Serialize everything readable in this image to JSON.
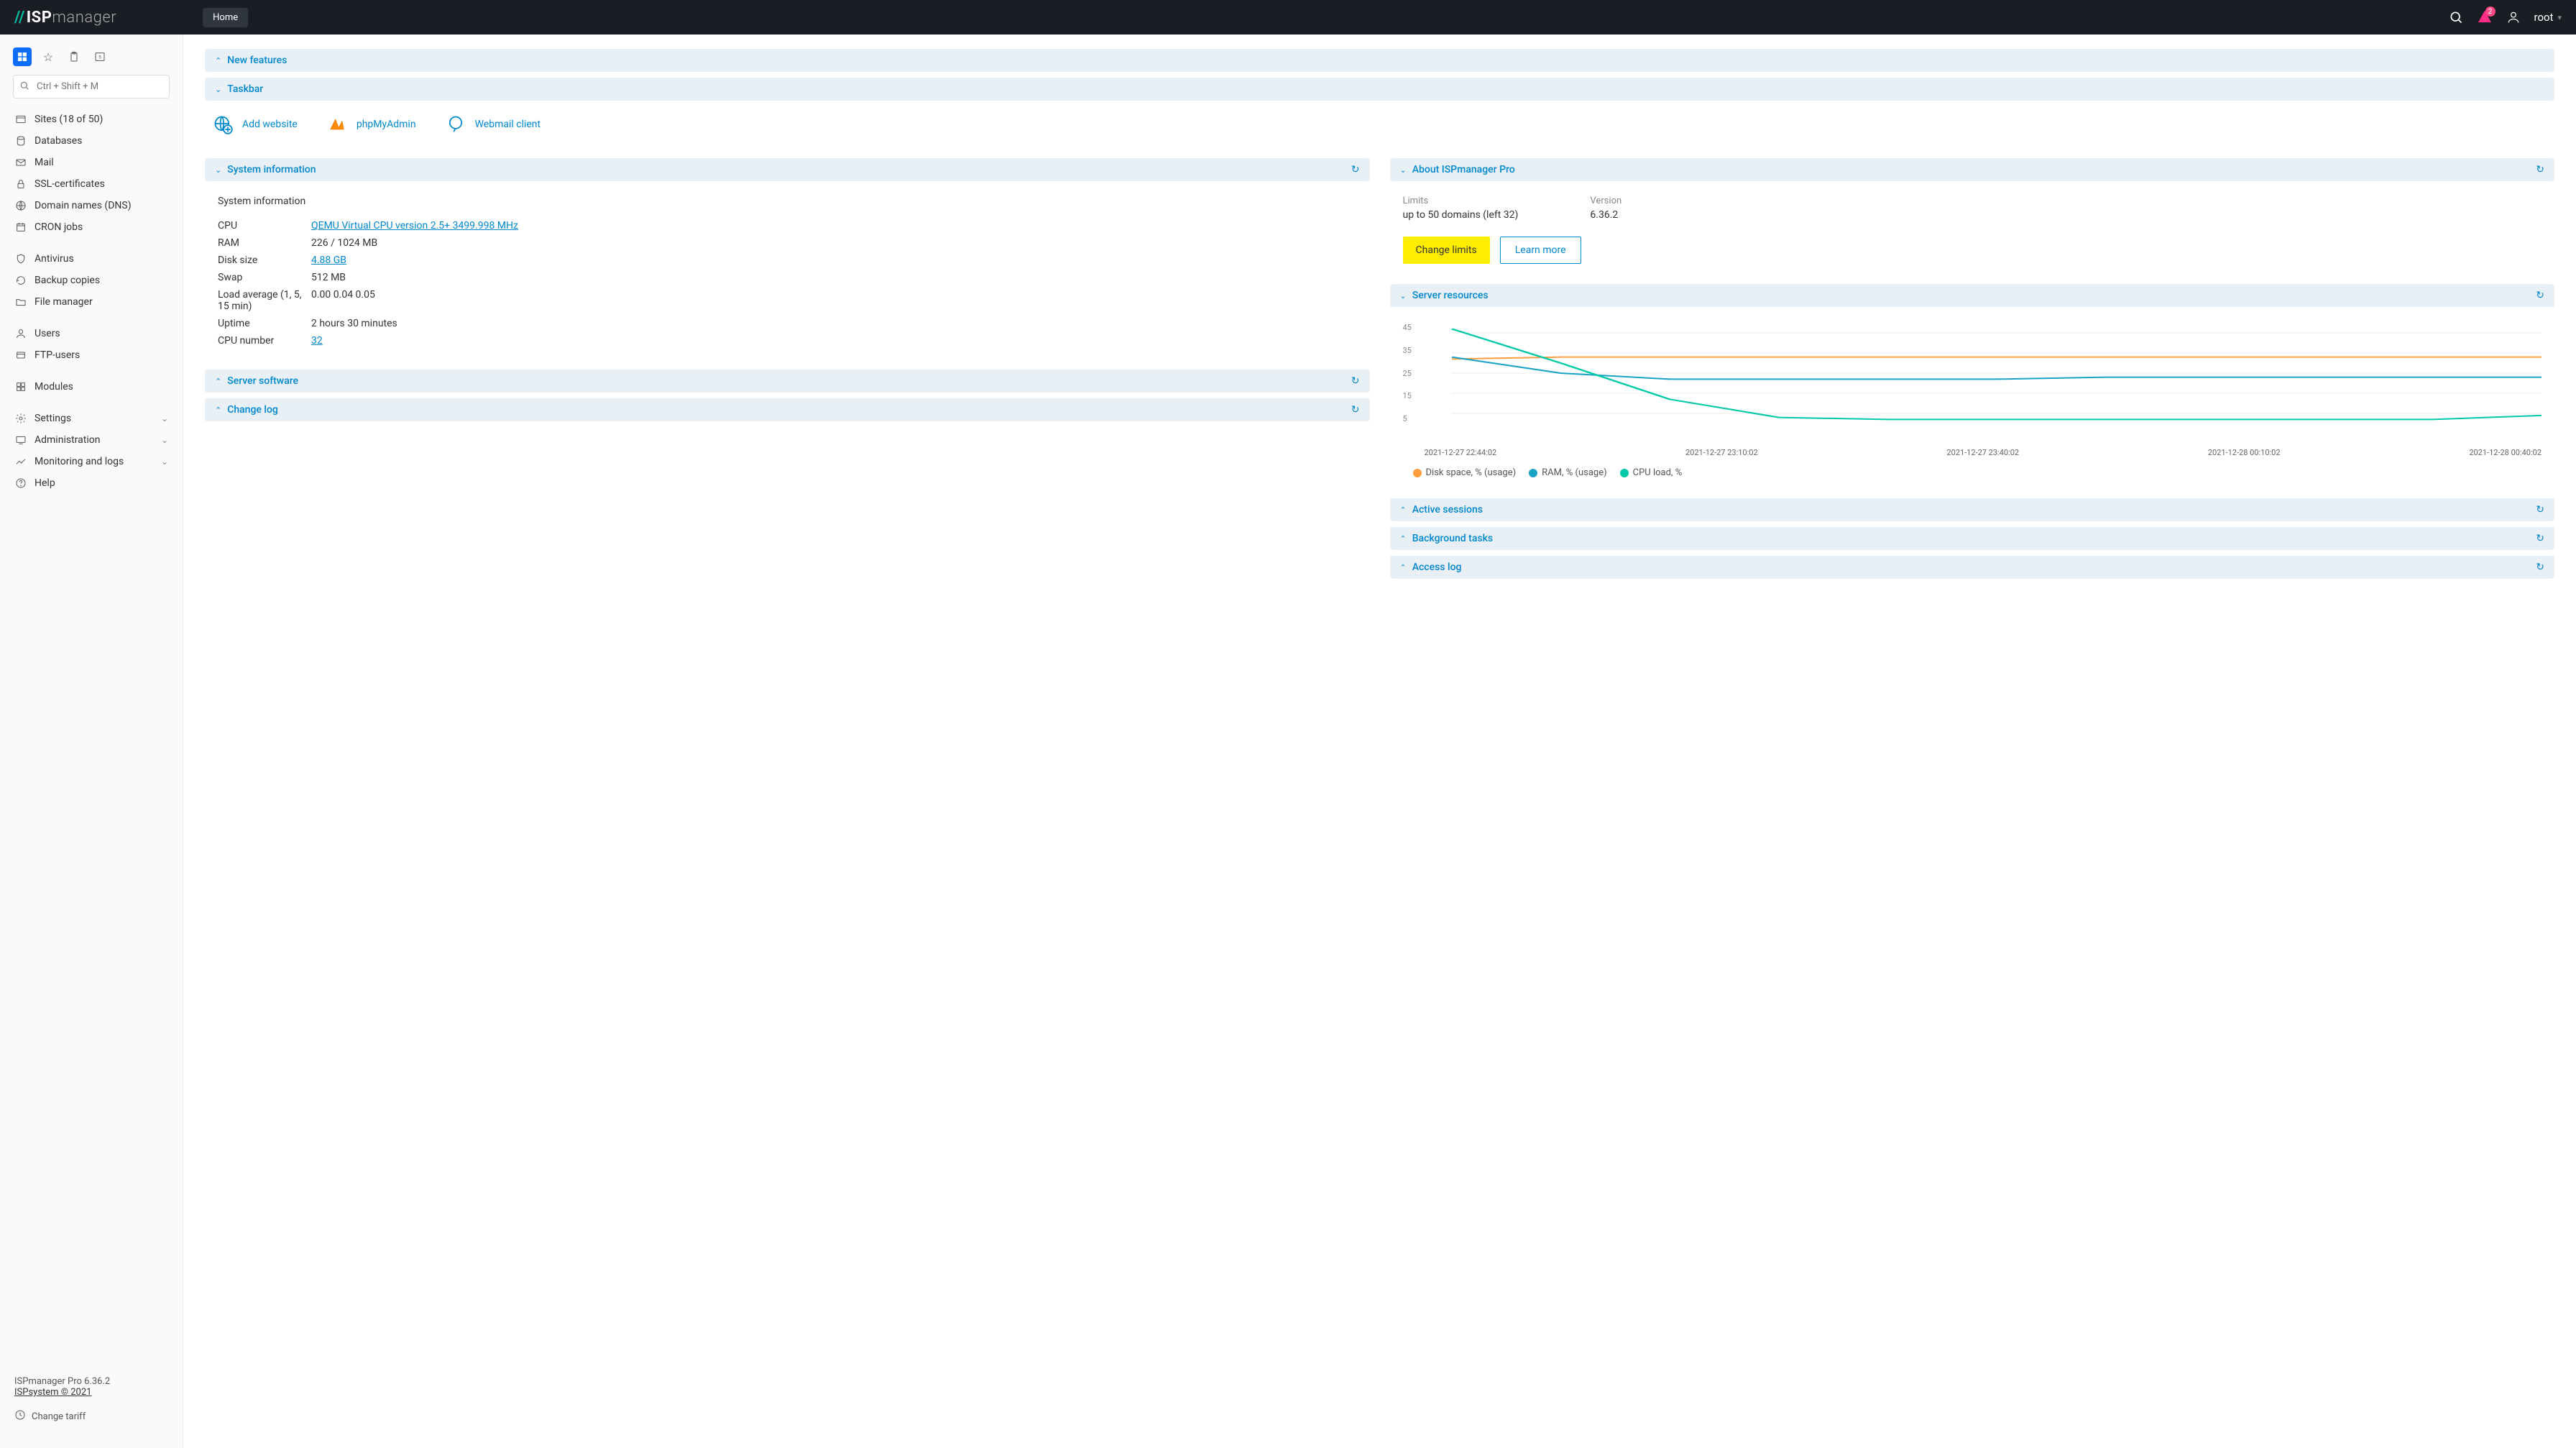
{
  "header": {
    "logo_prefix": "//",
    "logo_isp": "ISP",
    "logo_manager": "manager",
    "home_btn": "Home",
    "notif_count": "2",
    "user": "root"
  },
  "sidebar": {
    "search_placeholder": "Ctrl + Shift + M",
    "groups": [
      [
        "Sites (18 of 50)",
        "Databases",
        "Mail",
        "SSL-certificates",
        "Domain names (DNS)",
        "CRON jobs"
      ],
      [
        "Antivirus",
        "Backup copies",
        "File manager"
      ],
      [
        "Users",
        "FTP-users"
      ],
      [
        "Modules"
      ],
      [
        "Settings",
        "Administration",
        "Monitoring and logs",
        "Help"
      ]
    ],
    "chevron_items": [
      "Settings",
      "Administration",
      "Monitoring and logs"
    ],
    "footer_version": "ISPmanager Pro 6.36.2",
    "footer_copyright": "ISPsystem © 2021",
    "change_tariff": "Change tariff"
  },
  "panels": {
    "new_features": "New features",
    "taskbar": "Taskbar",
    "system_info": "System information",
    "server_software": "Server software",
    "change_log": "Change log",
    "about": "About ISPmanager Pro",
    "server_resources": "Server resources",
    "active_sessions": "Active sessions",
    "background_tasks": "Background tasks",
    "access_log": "Access log"
  },
  "taskbar": {
    "add_website": "Add website",
    "phpmyadmin": "phpMyAdmin",
    "webmail": "Webmail client"
  },
  "sysinfo": {
    "title": "System information",
    "rows": {
      "cpu_label": "CPU",
      "cpu_value": "QEMU Virtual CPU version 2.5+ 3499.998 MHz",
      "ram_label": "RAM",
      "ram_value": "226 / 1024 MB",
      "disk_label": "Disk size",
      "disk_value": "4.88 GB",
      "swap_label": "Swap",
      "swap_value": "512 MB",
      "load_label": "Load average (1, 5, 15 min)",
      "load_value": "0.00 0.04 0.05",
      "uptime_label": "Uptime",
      "uptime_value": "2 hours 30 minutes",
      "cpunum_label": "CPU number",
      "cpunum_value": "32"
    }
  },
  "about": {
    "limits_label": "Limits",
    "limits_value": "up to 50 domains (left 32)",
    "version_label": "Version",
    "version_value": "6.36.2",
    "change_limits_btn": "Change limits",
    "learn_more_btn": "Learn more"
  },
  "chart_data": {
    "type": "line",
    "ylim": [
      0,
      50
    ],
    "yticks": [
      5,
      15,
      25,
      35,
      45
    ],
    "xticks": [
      "2021-12-27 22:44:02",
      "2021-12-27 23:10:02",
      "2021-12-27 23:40:02",
      "2021-12-28 00:10:02",
      "2021-12-28 00:40:02"
    ],
    "series": [
      {
        "name": "Disk space, % (usage)",
        "color": "#ff9e40",
        "values": [
          32,
          33,
          33,
          33,
          33,
          33,
          33,
          33,
          33,
          33,
          33
        ]
      },
      {
        "name": "RAM, % (usage)",
        "color": "#1ba3c6",
        "values": [
          33,
          25,
          22,
          22,
          22,
          22,
          23,
          23,
          23,
          23,
          23
        ]
      },
      {
        "name": "CPU load, %",
        "color": "#00c9a7",
        "values": [
          47,
          30,
          12,
          3,
          2,
          2,
          2,
          2,
          2,
          2,
          4
        ]
      }
    ]
  },
  "legend": {
    "disk": "Disk space, % (usage)",
    "ram": "RAM, % (usage)",
    "cpu": "CPU load, %"
  }
}
